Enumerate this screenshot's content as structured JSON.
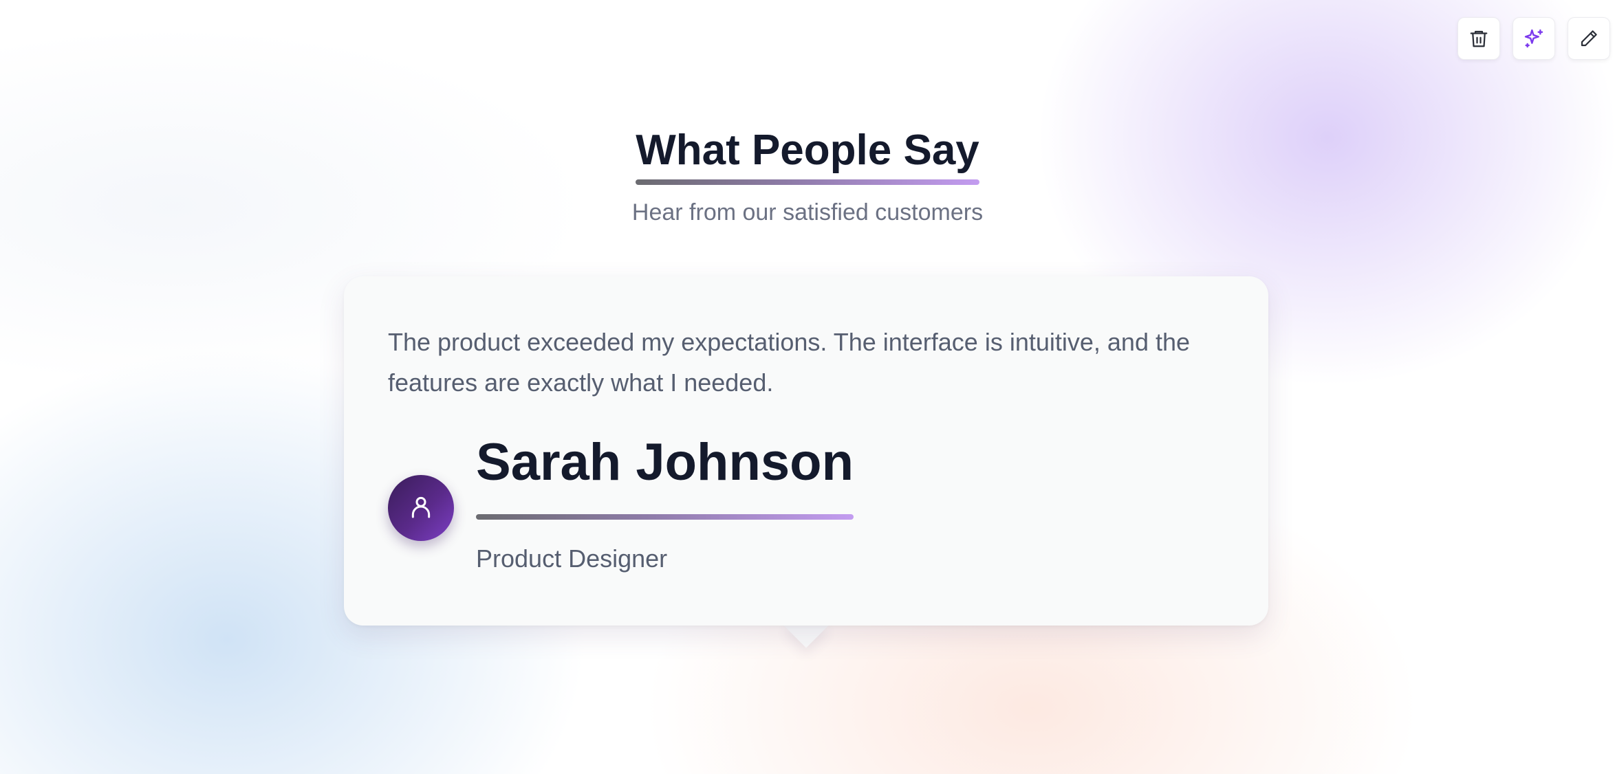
{
  "toolbar": {
    "buttons": [
      {
        "icon": "trash-icon",
        "label": "Delete"
      },
      {
        "icon": "sparkles-icon",
        "label": "AI"
      },
      {
        "icon": "pencil-icon",
        "label": "Edit"
      }
    ]
  },
  "header": {
    "title": "What People Say",
    "subtitle": "Hear from our satisfied customers"
  },
  "testimonial": {
    "quote": "The product exceeded my expectations. The interface is intuitive, and the features are exactly what I needed.",
    "author_name": "Sarah Johnson",
    "author_role": "Product Designer",
    "avatar_icon": "user-icon"
  },
  "colors": {
    "accent_purple": "#7c3aed",
    "text_dark": "#141a2c",
    "text_muted": "#565e70"
  }
}
